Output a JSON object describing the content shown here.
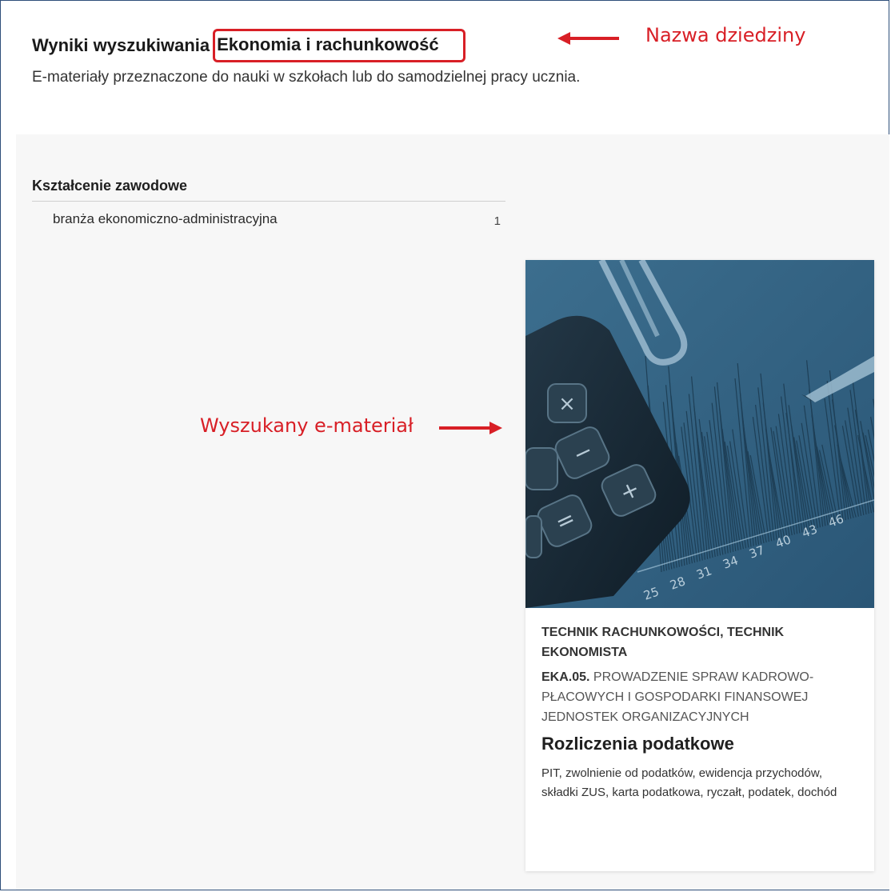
{
  "header": {
    "title_prefix": "Wyniki wyszukiwania",
    "title_field": "Ekonomia i rachunkowość",
    "subtitle": "E-materiały przeznaczone do nauki w szkołach lub do samodzielnej pracy ucznia."
  },
  "annotations": {
    "field_label": "Nazwa dziedziny",
    "material_label": "Wyszukany e-materiał"
  },
  "filters": {
    "heading": "Kształcenie zawodowe",
    "items": [
      {
        "label": "branża ekonomiczno-administracyjna",
        "count": "1"
      }
    ]
  },
  "card": {
    "category": "TECHNIK RACHUNKOWOŚCI, TECHNIK EKONOMISTA",
    "qualification_code": "EKA.05.",
    "qualification_name": "PROWADZENIE SPRAW KADROWO-PŁACOWYCH I GOSPODARKI FINANSOWEJ JEDNOSTEK ORGANIZACYJNYCH",
    "title": "Rozliczenia podatkowe",
    "tags": "PIT, zwolnienie od podatków, ewidencja przychodów, składki ZUS, karta podatkowa, ryczałt, podatek, dochód",
    "image": {
      "description_icon": "calculator-and-chart-image",
      "scale_numbers": [
        "25",
        "28",
        "31",
        "34",
        "37",
        "40",
        "43",
        "46"
      ]
    }
  },
  "colors": {
    "annotation_red": "#d81f26",
    "image_tint": "#2f5f80",
    "content_bg": "#f7f7f7"
  }
}
